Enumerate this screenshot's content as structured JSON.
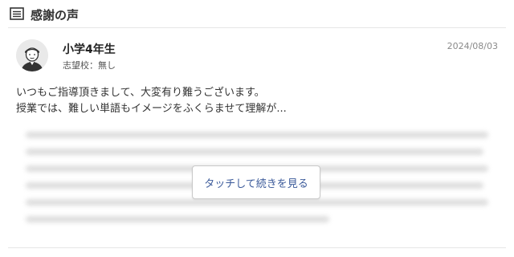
{
  "header": {
    "title": "感謝の声",
    "icon": "list-icon"
  },
  "review": {
    "grade": "小学4年生",
    "school": "志望校：無し",
    "date": "2024/08/03",
    "lines": [
      "いつもご指導頂きまして、大変有り難うございます。",
      "授業では、難しい単語もイメージをふくらませて理解が..."
    ],
    "more_button": "タッチして続きを見る"
  }
}
